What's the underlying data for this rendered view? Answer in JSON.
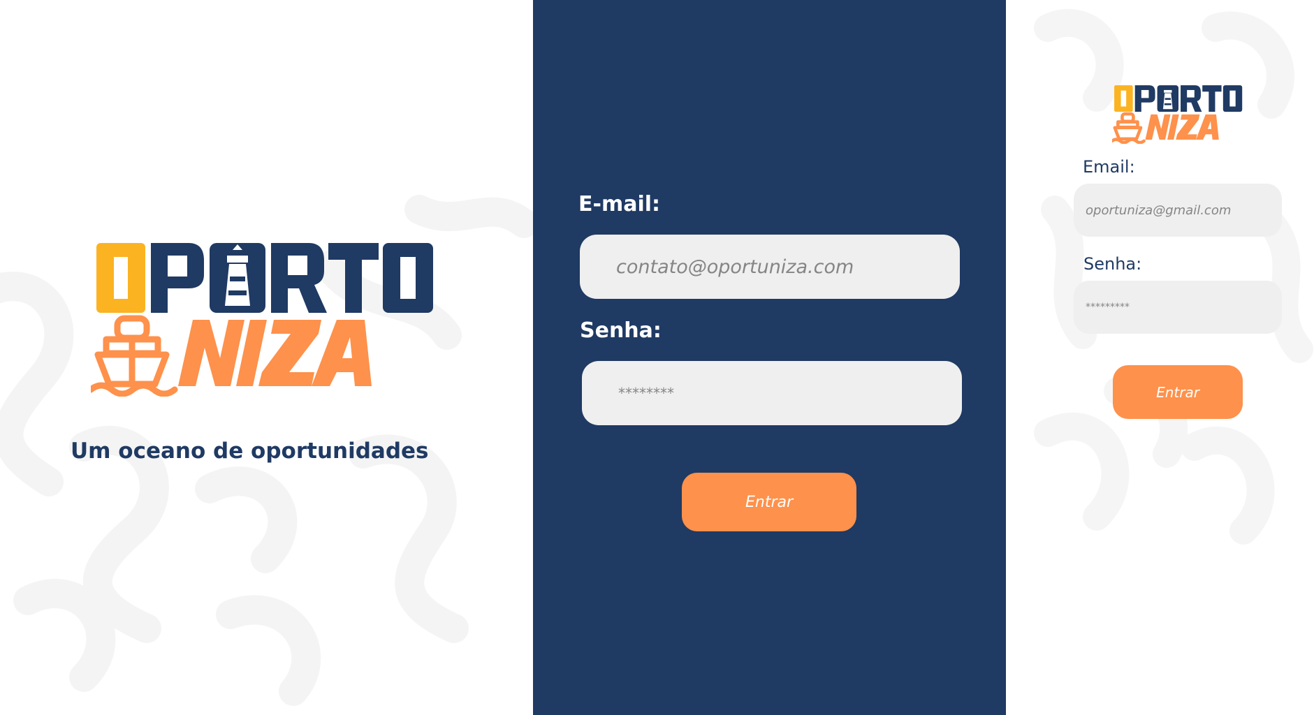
{
  "colors": {
    "navy": "#1f3a63",
    "orange": "#fe914b",
    "yellow": "#fbb322",
    "field_bg": "#efefef",
    "pattern": "#f3f3f3"
  },
  "brand": {
    "logo_text_top": "OPORTO",
    "logo_text_bottom": "NIZA",
    "tagline": "Um oceano de oportunidades"
  },
  "desktop_form": {
    "email_label": "E-mail:",
    "email_placeholder": "contato@oportuniza.com",
    "password_label": "Senha:",
    "password_placeholder": "********",
    "submit_label": "Entrar"
  },
  "mobile_form": {
    "email_label": "Email:",
    "email_placeholder": "oportuniza@gmail.com",
    "password_label": "Senha:",
    "password_placeholder": "*********",
    "submit_label": "Entrar"
  },
  "icons": [
    "lighthouse-icon",
    "ship-icon"
  ]
}
